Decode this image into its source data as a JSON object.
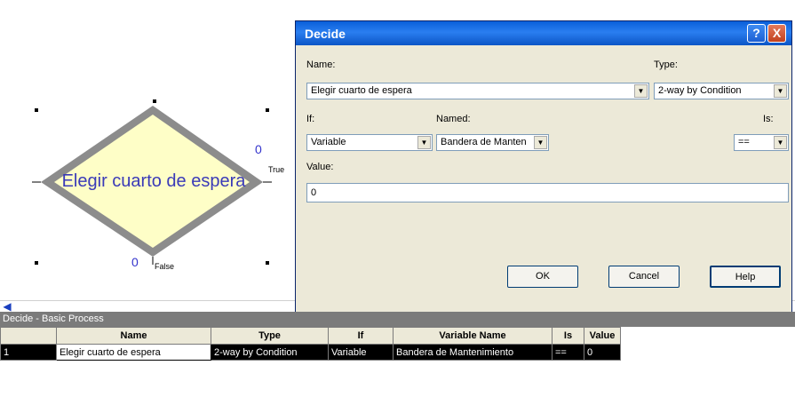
{
  "flowchart": {
    "module_label": "Elegir cuarto de espera",
    "true_label": "True",
    "false_label": "False",
    "true_counter": "0",
    "false_counter": "0"
  },
  "dialog": {
    "title": "Decide",
    "help_glyph": "?",
    "close_glyph": "X",
    "name_label": "Name:",
    "name_value": "Elegir cuarto de espera",
    "type_label": "Type:",
    "type_value": "2-way by Condition",
    "if_label": "If:",
    "if_value": "Variable",
    "named_label": "Named:",
    "named_value": "Bandera de Manten",
    "is_label": "Is:",
    "is_value": "==",
    "value_label": "Value:",
    "value_value": "0",
    "ok_label": "OK",
    "cancel_label": "Cancel",
    "help_label": "Help"
  },
  "grid": {
    "title": "Decide - Basic Process",
    "columns": [
      "Name",
      "Type",
      "If",
      "Variable Name",
      "Is",
      "Value"
    ],
    "row_number": "1",
    "row": [
      "Elegir cuarto de espera",
      "2-way by Condition",
      "Variable",
      "Bandera de Mantenimiento",
      "==",
      "0"
    ]
  },
  "colors": {
    "diamond_fill": "#fefec7",
    "diamond_border": "#8c8c8c",
    "label_blue": "#3a3ab8",
    "titlebar": "#0a5fd9"
  }
}
